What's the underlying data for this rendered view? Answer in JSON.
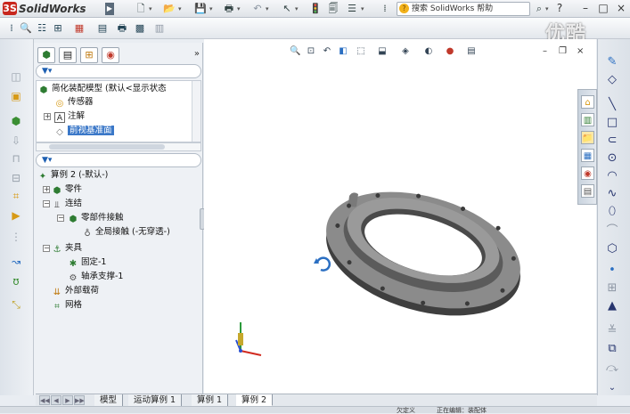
{
  "app": {
    "name": "SolidWorks",
    "watermark": "优酷"
  },
  "search": {
    "placeholder": "搜索 SolidWorks 帮助"
  },
  "window_controls": [
    "?",
    "–",
    "□",
    "×"
  ],
  "feature_manager": {
    "upper_tree": [
      {
        "label": "简化装配模型   (默认<显示状态"
      },
      {
        "label": "传感器"
      },
      {
        "label": "注解"
      },
      {
        "label": "前视基准面"
      }
    ],
    "lower_tree": [
      {
        "label": "算例 2 (-默认-)"
      },
      {
        "label": "零件"
      },
      {
        "label": "连结"
      },
      {
        "label": "零部件接触"
      },
      {
        "label": "全局接触 (-无穿透-)"
      },
      {
        "label": "夹具"
      },
      {
        "label": "固定-1"
      },
      {
        "label": "轴承支撑-1"
      },
      {
        "label": "外部载荷"
      },
      {
        "label": "网格"
      }
    ]
  },
  "bottom_tabs": [
    "模型",
    "运动算例 1",
    "算例 1",
    "算例 2"
  ],
  "status": {
    "left": "",
    "middle": "欠定义",
    "right": "正在编辑：装配体"
  },
  "colors": {
    "accent": "#3b78c8",
    "logo": "#c8261d",
    "part": "#6f6f6f"
  },
  "icons": {
    "titlebar": [
      "new-file-icon",
      "open-icon",
      "save-icon",
      "print-icon",
      "undo-icon",
      "select-icon",
      "rebuild-icon",
      "options-icon"
    ],
    "rightbar": [
      "sketch-icon",
      "smart-dimension-icon",
      "line-icon",
      "rectangle-icon",
      "slot-icon",
      "circle-icon",
      "arc-icon",
      "spline-icon",
      "ellipse-icon",
      "fillet-icon",
      "point-icon",
      "centerline-icon",
      "text-icon",
      "trim-icon",
      "mirror-icon",
      "offset-icon",
      "scroll-down-icon"
    ]
  }
}
